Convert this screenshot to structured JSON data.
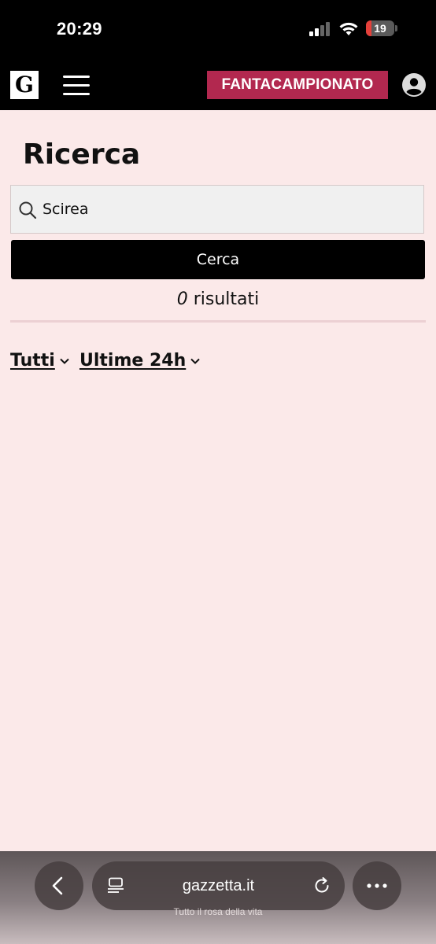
{
  "status_bar": {
    "time": "20:29",
    "battery_level": "19",
    "battery_fraction": 0.19,
    "signal_icon": "cellular-signal-icon",
    "wifi_icon": "wifi-icon"
  },
  "header": {
    "logo": "G",
    "menu_icon": "hamburger-menu-icon",
    "fantacampionato_label": "FANTACAMPIONATO",
    "account_icon": "user-account-icon"
  },
  "search": {
    "title": "Ricerca",
    "query": "Scirea",
    "button_label": "Cerca",
    "results_count": "0",
    "results_label": "risultati"
  },
  "filters": {
    "type": "Tutti",
    "period": "Ultime 24h"
  },
  "browser": {
    "url": "gazzetta.it",
    "tagline": "Tutto il rosa della vita"
  },
  "colors": {
    "page_background": "#fbe9e9",
    "header_background": "#000000",
    "accent": "#b2284f",
    "search_button": "#000000"
  }
}
